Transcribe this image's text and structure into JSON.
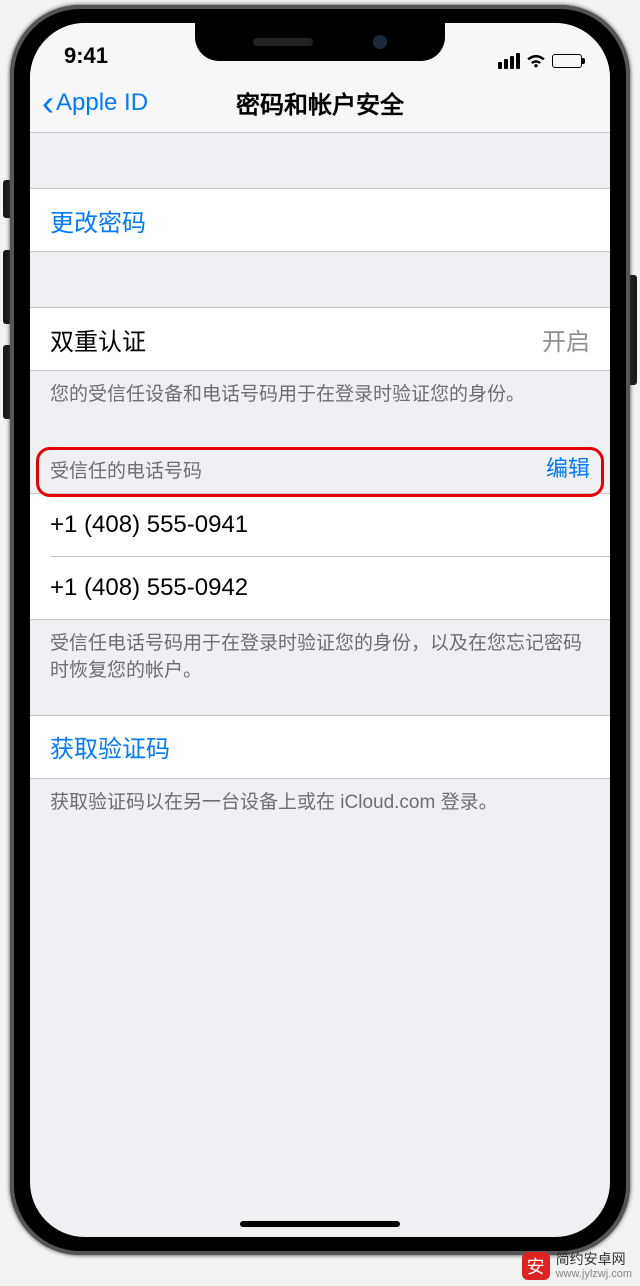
{
  "status": {
    "time": "9:41"
  },
  "nav": {
    "back_label": "Apple ID",
    "title": "密码和帐户安全"
  },
  "change_password": {
    "label": "更改密码"
  },
  "two_factor": {
    "label": "双重认证",
    "value": "开启",
    "footer": "您的受信任设备和电话号码用于在登录时验证您的身份。"
  },
  "trusted_numbers": {
    "header": "受信任的电话号码",
    "edit_label": "编辑",
    "items": [
      "+1 (408) 555-0941",
      "+1 (408) 555-0942"
    ],
    "footer": "受信任电话号码用于在登录时验证您的身份，以及在您忘记密码时恢复您的帐户。"
  },
  "get_code": {
    "label": "获取验证码",
    "footer": "获取验证码以在另一台设备上或在 iCloud.com 登录。"
  },
  "watermark": {
    "name": "简约安卓网",
    "url": "www.jylzwj.com"
  }
}
